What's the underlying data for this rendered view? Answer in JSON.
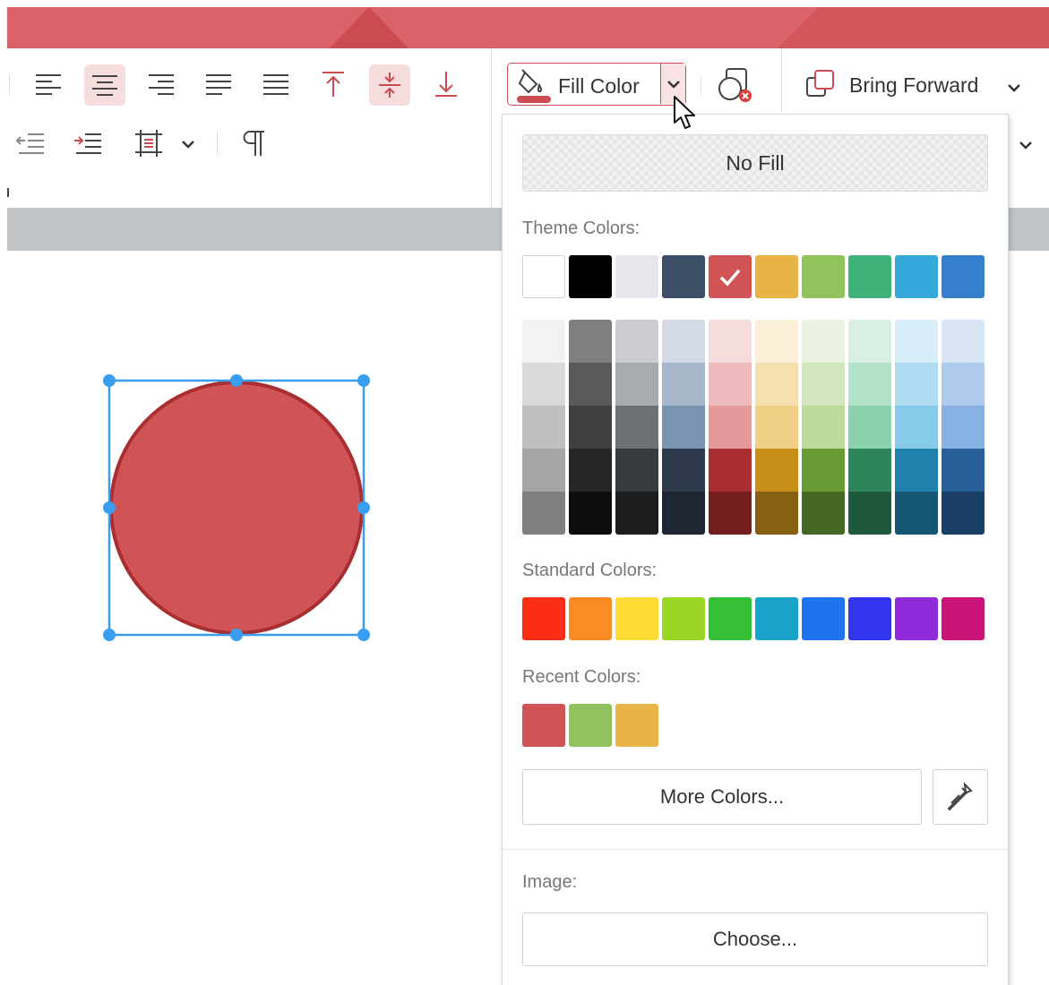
{
  "toolbar": {
    "fill_color_label": "Fill Color",
    "bring_forward_label": "Bring Forward"
  },
  "fill_panel": {
    "no_fill_label": "No Fill",
    "theme_colors_label": "Theme Colors:",
    "theme_colors": [
      "#ffffff",
      "#000000",
      "#e5e7ea",
      "#3c4f67",
      "#d05456",
      "#e8b347",
      "#92c25d",
      "#3fb27a",
      "#36a9db",
      "#357fcc"
    ],
    "selected_theme_color": "#d05456",
    "theme_shades": [
      [
        "#f2f2f2",
        "#d9d9d9",
        "#bfbfbf",
        "#a6a6a6",
        "#7f7f7f"
      ],
      [
        "#7f7f7f",
        "#595959",
        "#3f3f3f",
        "#262626",
        "#0d0d0d"
      ],
      [
        "#cbcdd0",
        "#a7abaf",
        "#6c7175",
        "#383b3e",
        "#1b1d1f"
      ],
      [
        "#d3dae4",
        "#a6b6cb",
        "#7a93b0",
        "#2d3b4d",
        "#1e2733"
      ],
      [
        "#f6dcdd",
        "#eebbbc",
        "#e49a9b",
        "#a92e30",
        "#731f20"
      ],
      [
        "#fbefd7",
        "#f6dfae",
        "#f0cf86",
        "#c98e17",
        "#865f10"
      ],
      [
        "#e9f3df",
        "#d3e7be",
        "#bedb9e",
        "#6a9b36",
        "#476724"
      ],
      [
        "#d8f0e4",
        "#b2e2c9",
        "#8bd3ae",
        "#2f855b",
        "#1f593d"
      ],
      [
        "#d7eef8",
        "#afdcf1",
        "#87cbea",
        "#2082ac",
        "#155772"
      ],
      [
        "#d7e5f5",
        "#aecbec",
        "#86b1e2",
        "#275f9b",
        "#1a3f67"
      ]
    ],
    "standard_colors_label": "Standard Colors:",
    "standard_colors": [
      "#fa2e14",
      "#fa8c24",
      "#fcdc34",
      "#9bd624",
      "#35bf35",
      "#19a3c9",
      "#1e73f0",
      "#3336ee",
      "#8f2bd9",
      "#c9147a"
    ],
    "recent_colors_label": "Recent Colors:",
    "recent_colors": [
      "#d05456",
      "#92c25d",
      "#e8b347"
    ],
    "more_colors_label": "More Colors...",
    "image_label": "Image:",
    "choose_label": "Choose..."
  },
  "colors": {
    "accent": "#cc4b52",
    "title_bar": "#da6268",
    "shape_fill": "#d05456",
    "shape_stroke": "#a92e30",
    "selection": "#3a9ef0"
  }
}
